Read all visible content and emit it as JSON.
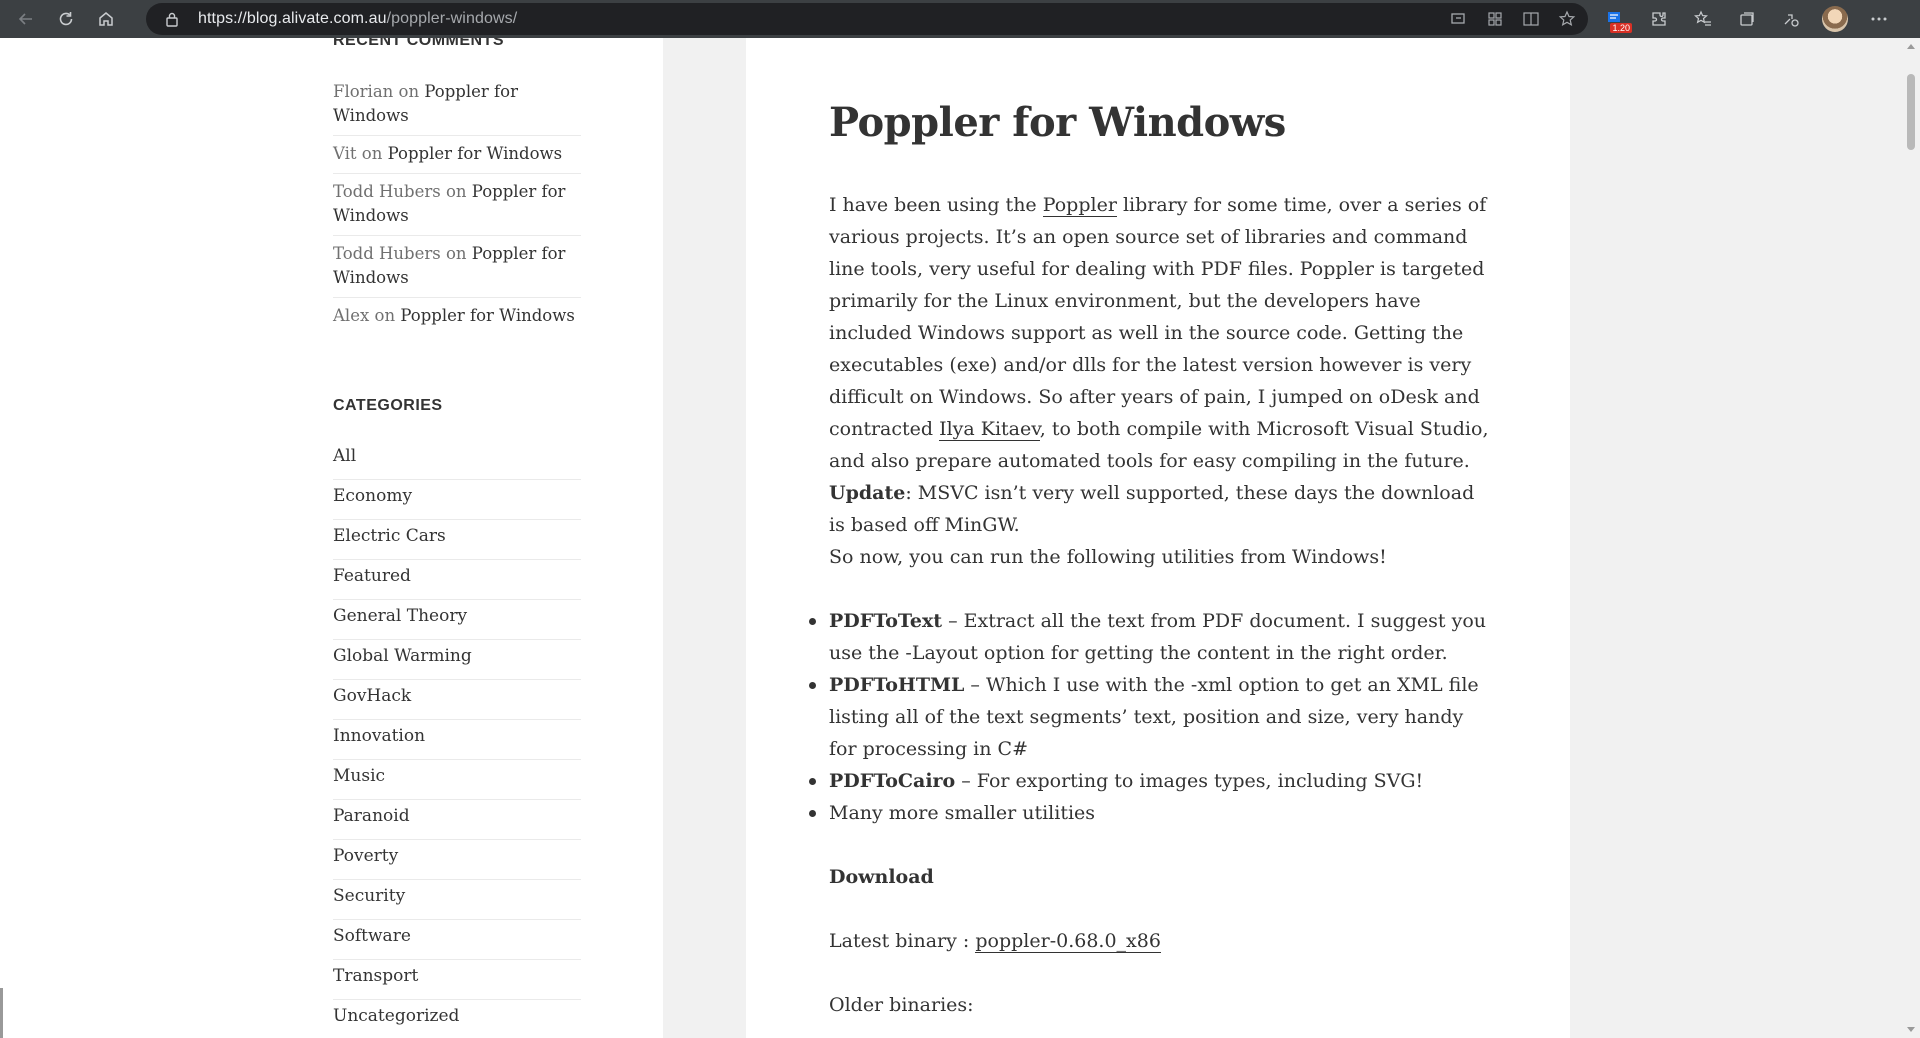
{
  "browser": {
    "url_host": "https://blog.alivate.com.au",
    "url_path": "/poppler-windows/",
    "badge": "1.20"
  },
  "sidebar": {
    "recent_comments_title": "RECENT COMMENTS",
    "recent_comments": [
      {
        "author": "Florian",
        "on": "on",
        "post": "Poppler for Windows"
      },
      {
        "author": "Vit",
        "on": "on",
        "post": "Poppler for Windows"
      },
      {
        "author": "Todd Hubers",
        "on": "on",
        "post": "Poppler for Windows"
      },
      {
        "author": "Todd Hubers",
        "on": "on",
        "post": "Poppler for Windows"
      },
      {
        "author": "Alex",
        "on": "on",
        "post": "Poppler for Windows"
      }
    ],
    "categories_title": "CATEGORIES",
    "categories": [
      "All",
      "Economy",
      "Electric Cars",
      "Featured",
      "General Theory",
      "Global Warming",
      "GovHack",
      "Innovation",
      "Music",
      "Paranoid",
      "Poverty",
      "Security",
      "Software",
      "Transport",
      "Uncategorized"
    ]
  },
  "article": {
    "title": "Poppler for Windows",
    "intro_1": "I have been using the ",
    "intro_link_poppler": "Poppler",
    "intro_2": " library for some time, over a series of various projects. It’s an open source set of libraries and command line tools, very useful for dealing with PDF files. Poppler is targeted primarily for the Linux environment, but the developers have included Windows support as well in the source code. Getting the executables (exe) and/or dlls for the latest version however is very difficult on Windows. So after years of pain, I jumped on oDesk and contracted ",
    "intro_link_ilya": "Ilya Kitaev",
    "intro_3": ", to both compile with Microsoft Visual Studio, and also prepare automated tools for easy compiling in the future. ",
    "update_label": "Update",
    "intro_4": ": MSVC isn’t very well supported, these days the download is based off MinGW.",
    "para_2": "So now, you can run the following utilities from Windows!",
    "bullets": [
      {
        "name": "PDFToText",
        "text": " – Extract all the text from PDF document. I suggest you use the -Layout option for getting the content in the right order."
      },
      {
        "name": "PDFToHTML",
        "text": " – Which I use with the -xml option to get an XML file listing all of the text segments’ text, position and size, very handy for processing in C#"
      },
      {
        "name": "PDFToCairo",
        "text": " – For exporting to images types, including SVG!"
      },
      {
        "name": "",
        "text": "Many more smaller utilities"
      }
    ],
    "download_heading": "Download",
    "latest_label": "Latest binary : ",
    "latest_link": "poppler-0.68.0_x86",
    "older_label": "Older binaries:"
  }
}
